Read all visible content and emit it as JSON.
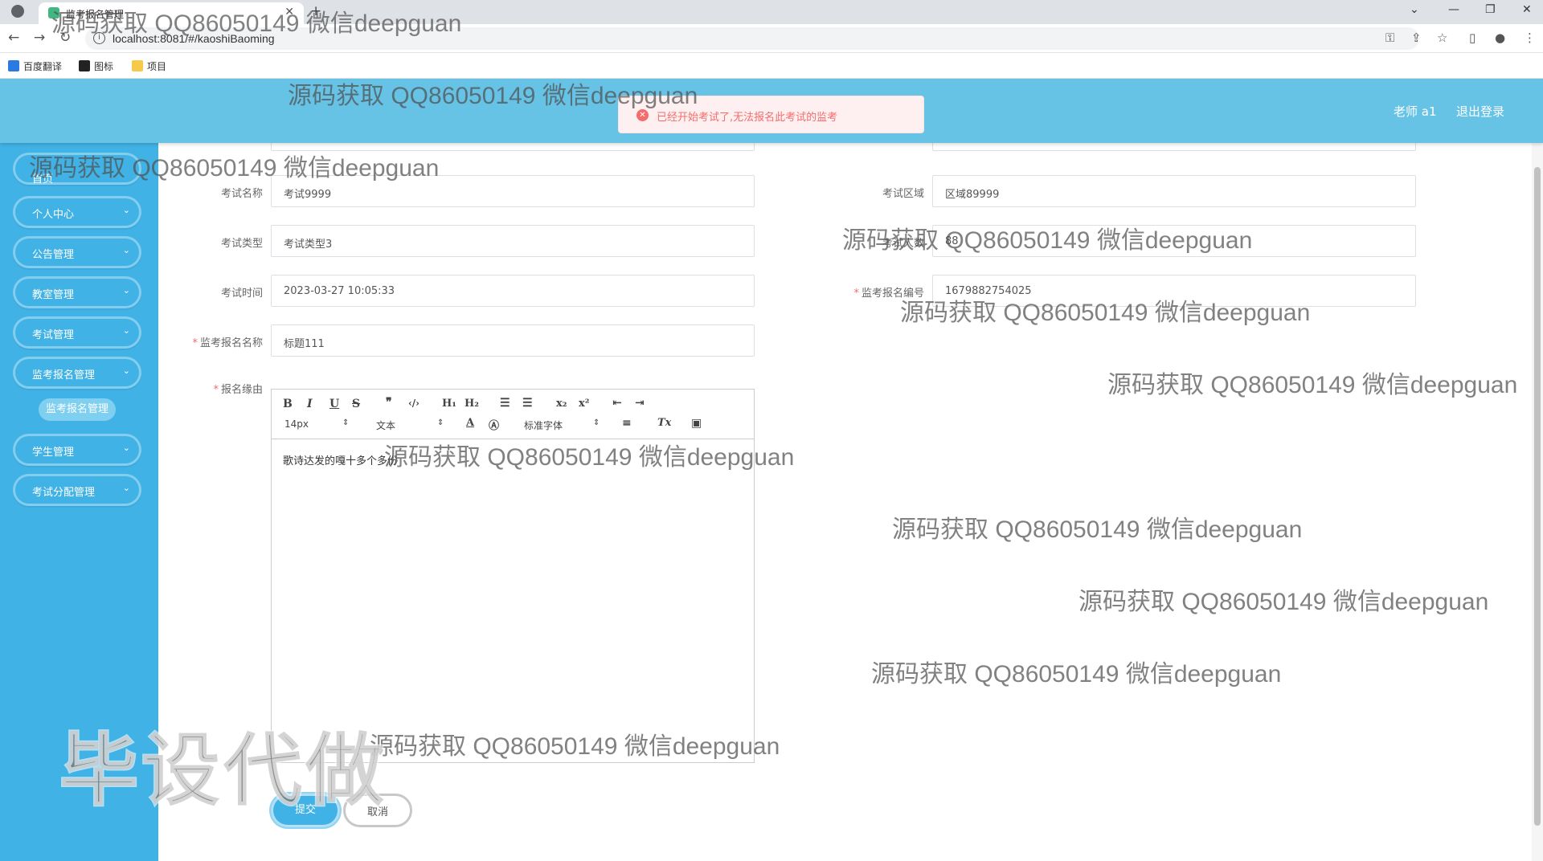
{
  "browser": {
    "tab_title": "监考报名管理",
    "url": "localhost:8081/#/kaoshiBaoming",
    "bookmarks": [
      "百度翻译",
      "图标",
      "项目"
    ]
  },
  "header": {
    "user": "老师 a1",
    "logout": "退出登录"
  },
  "toast": {
    "message": "已经开始考试了,无法报名此考试的监考"
  },
  "sidebar": {
    "items": [
      {
        "label": "首页"
      },
      {
        "label": "个人中心"
      },
      {
        "label": "公告管理"
      },
      {
        "label": "教室管理"
      },
      {
        "label": "考试管理"
      },
      {
        "label": "监考报名管理"
      },
      {
        "label": "学生管理"
      },
      {
        "label": "考试分配管理"
      }
    ],
    "sub_item": "监考报名管理"
  },
  "form": {
    "exam_name_label": "考试名称",
    "exam_name": "考试9999",
    "exam_area_label": "考试区域",
    "exam_area": "区域89999",
    "exam_type_label": "考试类型",
    "exam_type": "考试类型3",
    "exam_count_label": "考试人数",
    "exam_count": "88",
    "exam_time_label": "考试时间",
    "exam_time": "2023-03-27 10:05:33",
    "signup_no_label": "监考报名编号",
    "signup_no": "1679882754025",
    "signup_name_label": "监考报名名称",
    "signup_name": "标题111",
    "reason_label": "报名缘由",
    "reason_text": "歌诗达发的嘎十多个多份"
  },
  "editor": {
    "font_size": "14px",
    "text_style": "文本",
    "font_family": "标准字体"
  },
  "buttons": {
    "submit": "提交",
    "cancel": "取消"
  },
  "watermark": {
    "text": "源码获取 QQ86050149 微信deepguan",
    "big": "毕设代做"
  }
}
